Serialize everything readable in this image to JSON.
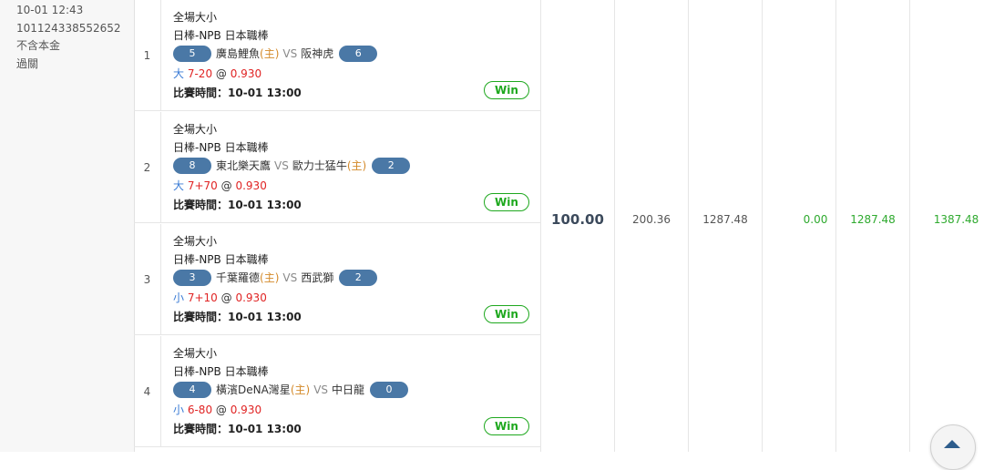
{
  "info": {
    "rows": [
      {
        "label": "：",
        "value": "10-01 12:43"
      },
      {
        "label": "：",
        "value": "101124338552652"
      },
      {
        "label": "：",
        "value": "不含本金"
      },
      {
        "label": "：",
        "value": "過關"
      }
    ]
  },
  "bets": [
    {
      "index": "1",
      "market": "全場大小",
      "league": "日棒-NPB 日本職棒",
      "team_a": {
        "score": "5",
        "name": "廣島鯉魚",
        "home_tag": "(主)"
      },
      "vs": "VS",
      "team_b": {
        "score": "6",
        "name": "阪神虎",
        "home_tag": ""
      },
      "selection": {
        "side": "大",
        "line": "7-20",
        "at": "@",
        "odds": "0.930"
      },
      "time_label": "比賽時間：",
      "time_value": "10-01 13:00",
      "result": "Win"
    },
    {
      "index": "2",
      "market": "全場大小",
      "league": "日棒-NPB 日本職棒",
      "team_a": {
        "score": "8",
        "name": "東北樂天鷹",
        "home_tag": ""
      },
      "vs": "VS",
      "team_b": {
        "score": "2",
        "name": "歐力士猛牛",
        "home_tag": "(主)"
      },
      "selection": {
        "side": "大",
        "line": "7+70",
        "at": "@",
        "odds": "0.930"
      },
      "time_label": "比賽時間：",
      "time_value": "10-01 13:00",
      "result": "Win"
    },
    {
      "index": "3",
      "market": "全場大小",
      "league": "日棒-NPB 日本職棒",
      "team_a": {
        "score": "3",
        "name": "千葉羅德",
        "home_tag": "(主)"
      },
      "vs": "VS",
      "team_b": {
        "score": "2",
        "name": "西武獅",
        "home_tag": ""
      },
      "selection": {
        "side": "小",
        "line": "7+10",
        "at": "@",
        "odds": "0.930"
      },
      "time_label": "比賽時間：",
      "time_value": "10-01 13:00",
      "result": "Win"
    },
    {
      "index": "4",
      "market": "全場大小",
      "league": "日棒-NPB 日本職棒",
      "team_a": {
        "score": "4",
        "name": "橫濱DeNA灣星",
        "home_tag": "(主)"
      },
      "vs": "VS",
      "team_b": {
        "score": "0",
        "name": "中日龍",
        "home_tag": ""
      },
      "selection": {
        "side": "小",
        "line": "6-80",
        "at": "@",
        "odds": "0.930"
      },
      "time_label": "比賽時間：",
      "time_value": "10-01 13:00",
      "result": "Win"
    }
  ],
  "summary": {
    "stake": "100.00",
    "odds_total": "200.36",
    "payout": "1287.48",
    "commission": "0.00",
    "win_amount": "1287.48",
    "total_return": "1387.48"
  },
  "colors": {
    "pill": "#4a78a6",
    "win": "#1ea81e",
    "home": "#d48a2a",
    "line_red": "#e02424",
    "side_blue": "#3a7bd5"
  },
  "icons": {
    "scroll_top": "triangle-up-icon"
  }
}
